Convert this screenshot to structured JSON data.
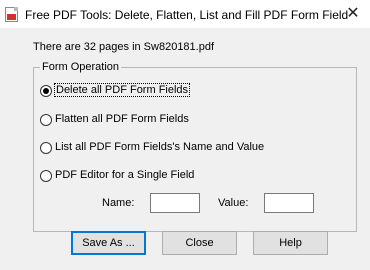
{
  "window": {
    "title": "Free PDF Tools: Delete, Flatten, List and Fill PDF Form Field",
    "close_glyph": "✕"
  },
  "info": {
    "pages_text": "There are 32 pages in Sw820181.pdf"
  },
  "form_operation": {
    "group_label": "Form Operation",
    "options": [
      {
        "label": "Delete all PDF Form Fields",
        "selected": true
      },
      {
        "label": "Flatten all PDF Form Fields",
        "selected": false
      },
      {
        "label": "List all PDF Form Fields's Name and Value",
        "selected": false
      },
      {
        "label": "PDF Editor for a Single Field",
        "selected": false
      }
    ],
    "name_label": "Name:",
    "name_value": "",
    "value_label": "Value:",
    "value_value": ""
  },
  "buttons": {
    "save_as": "Save As ...",
    "close": "Close",
    "help": "Help"
  }
}
